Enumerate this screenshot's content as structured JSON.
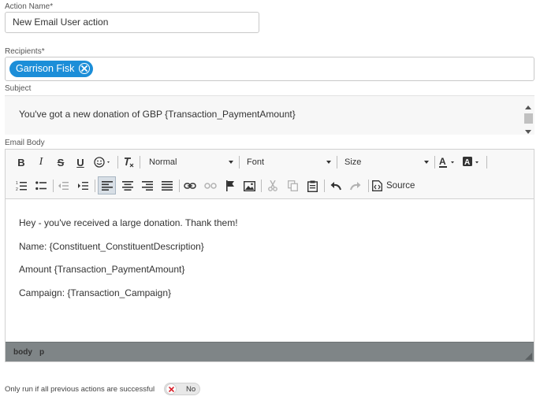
{
  "form": {
    "action_name_label": "Action Name*",
    "action_name_value": "New Email User action",
    "recipients_label": "Recipients*",
    "recipient_chip": "Garrison Fisk",
    "subject_label": "Subject",
    "subject_value": "You've got a new donation of GBP {Transaction_PaymentAmount}",
    "email_body_label": "Email Body"
  },
  "toolbar": {
    "format_value": "Normal",
    "font_value": "Font",
    "size_value": "Size",
    "source_label": "Source"
  },
  "body_lines": [
    "Hey - you've received a large donation. Thank them!",
    "Name: {Constituent_ConstituentDescription}",
    "Amount {Transaction_PaymentAmount}",
    "Campaign: {Transaction_Campaign}"
  ],
  "statusbar": {
    "path": [
      "body",
      "p"
    ]
  },
  "condition": {
    "label": "Only run if all previous actions are successful",
    "toggle_text": "No"
  },
  "colors": {
    "chip_bg": "#1c8ed8",
    "statusbar_bg": "#7f8587",
    "toggle_x": "#d9232d"
  }
}
